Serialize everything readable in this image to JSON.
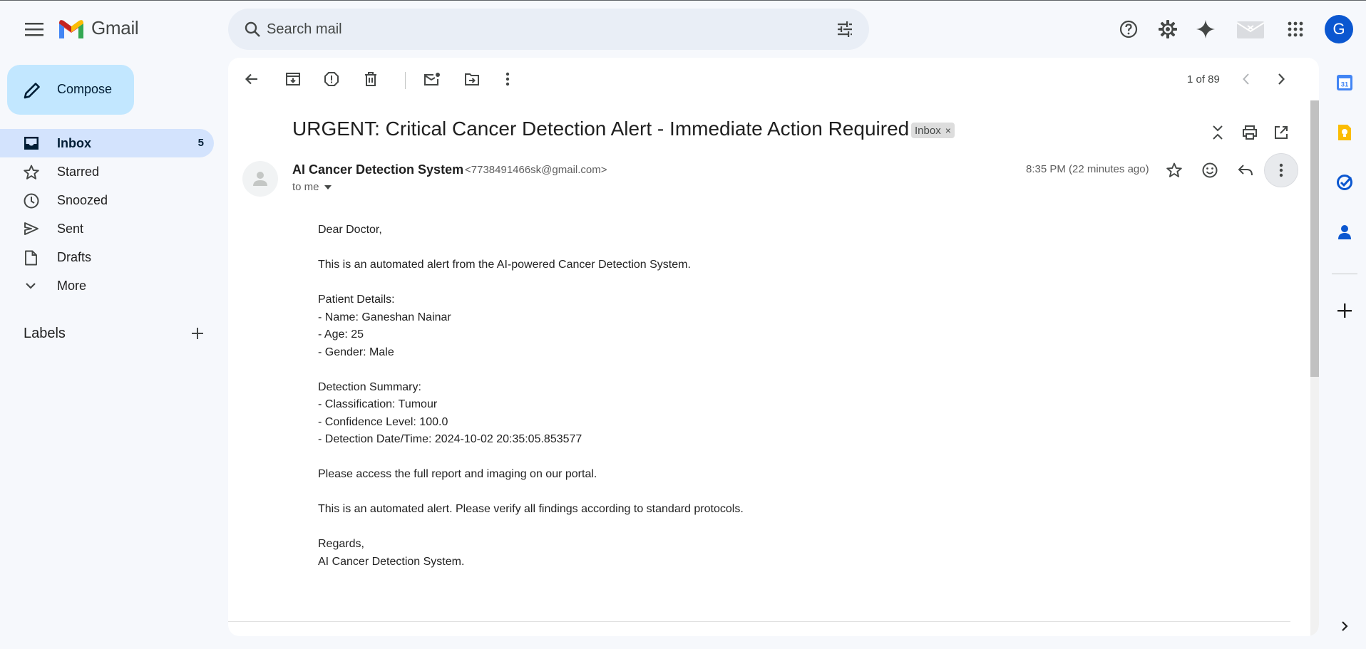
{
  "app": {
    "name": "Gmail"
  },
  "search": {
    "placeholder": "Search mail"
  },
  "compose": {
    "label": "Compose"
  },
  "sidebar": {
    "items": [
      {
        "label": "Inbox",
        "count": "5",
        "icon": "inbox-icon"
      },
      {
        "label": "Starred",
        "icon": "star-icon"
      },
      {
        "label": "Snoozed",
        "icon": "clock-icon"
      },
      {
        "label": "Sent",
        "icon": "send-icon"
      },
      {
        "label": "Drafts",
        "icon": "draft-icon"
      },
      {
        "label": "More",
        "icon": "chevron-down-icon"
      }
    ],
    "labels_title": "Labels"
  },
  "profile": {
    "initial": "G",
    "color": "#0b57d0"
  },
  "toolbar": {
    "pager": "1 of 89"
  },
  "message": {
    "subject": "URGENT: Critical Cancer Detection Alert - Immediate Action Required",
    "label_chip": "Inbox",
    "label_chip_close": "×",
    "sender_name": "AI Cancer Detection System",
    "sender_email": "<7738491466sk@gmail.com>",
    "recipient": "to me",
    "time": "8:35 PM (22 minutes ago)",
    "body": [
      "Dear Doctor,",
      "",
      "This is an automated alert from the AI-powered Cancer Detection System.",
      "",
      "Patient Details:",
      "- Name: Ganeshan Nainar",
      "- Age: 25",
      "- Gender: Male",
      "",
      "Detection Summary:",
      "- Classification: Tumour",
      "- Confidence Level: 100.0",
      "- Detection Date/Time: 2024-10-02 20:35:05.853577",
      "",
      "Please access the full report and imaging on our portal.",
      "",
      "This is an automated alert. Please verify all findings according to standard protocols.",
      "",
      "Regards,",
      "AI Cancer Detection System."
    ]
  },
  "side_panel": {
    "calendar_day": "31",
    "apps": [
      "calendar-icon",
      "keep-icon",
      "tasks-icon",
      "contacts-icon",
      "add-icon"
    ]
  },
  "colors": {
    "background": "#f6f8fc",
    "compose": "#c2e7ff",
    "active_nav": "#d3e3fd",
    "search": "#e9eef6"
  }
}
